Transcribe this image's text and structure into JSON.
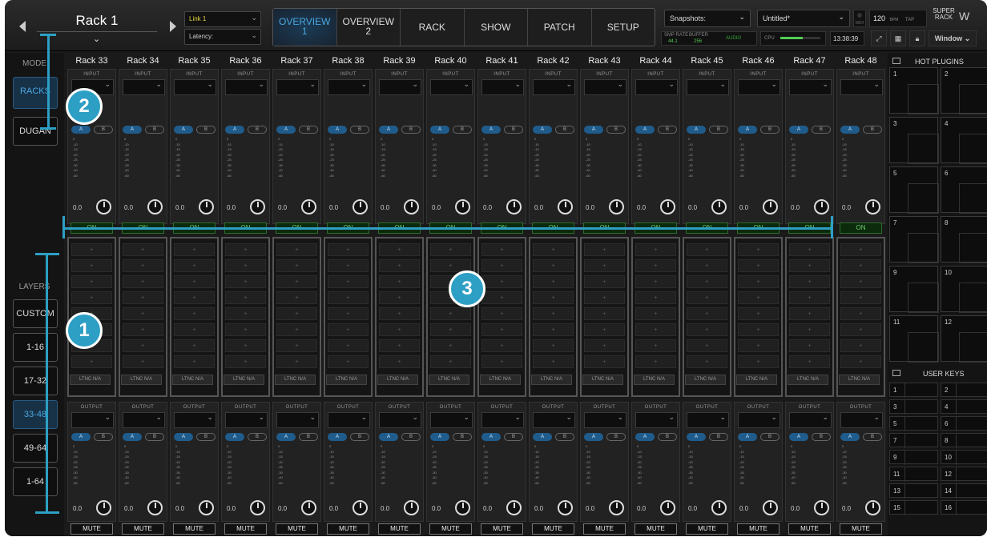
{
  "header": {
    "rack_name": "Rack 1",
    "link_label": "Link 1",
    "latency_label": "Latency:",
    "tabs": [
      {
        "line1": "OVERVIEW",
        "line2": "1",
        "active": true
      },
      {
        "line1": "OVERVIEW",
        "line2": "2",
        "active": false
      },
      {
        "line1": "RACK",
        "line2": "",
        "active": false
      },
      {
        "line1": "SHOW",
        "line2": "",
        "active": false
      },
      {
        "line1": "PATCH",
        "line2": "",
        "active": false
      },
      {
        "line1": "SETUP",
        "line2": "",
        "active": false
      }
    ],
    "snapshots_label": "Snapshots:",
    "snapshot_name": "Untitled*",
    "midi_label": "MIDI",
    "bpm_value": "120",
    "bpm_label": "BPM",
    "tap_label": "TAP",
    "brand": "SUPER RACK",
    "smp_rate_label": "SMP RATE",
    "smp_rate_value": "44.1",
    "buffer_label": "BUFFER",
    "buffer_value": "256",
    "audio_label": "AUDIO",
    "cpu_label": "CPU",
    "cpu_level": 0.55,
    "time": "13:38:39",
    "window_label": "Window"
  },
  "sidebar": {
    "mode_label": "MODE",
    "modes": [
      {
        "label": "RACKS",
        "active": true
      },
      {
        "label": "DUGAN",
        "active": false
      }
    ],
    "layers_label": "LAYERS",
    "layers": [
      {
        "label": "CUSTOM",
        "active": false
      },
      {
        "label": "1-16",
        "active": false
      },
      {
        "label": "17-32",
        "active": false
      },
      {
        "label": "33-48",
        "active": true
      },
      {
        "label": "49-64",
        "active": false
      },
      {
        "label": "1-64",
        "active": false
      }
    ]
  },
  "racks": {
    "names": [
      "Rack 33",
      "Rack 34",
      "Rack 35",
      "Rack 36",
      "Rack 37",
      "Rack 38",
      "Rack 39",
      "Rack 40",
      "Rack 41",
      "Rack 42",
      "Rack 43",
      "Rack 44",
      "Rack 45",
      "Rack 46",
      "Rack 47",
      "Rack 48"
    ],
    "input_label": "INPUT",
    "output_label": "OUTPUT",
    "a_label": "A",
    "b_label": "B",
    "meter_scale": [
      "0",
      "-10",
      "-15",
      "-20",
      "-25",
      "-30",
      "-40",
      "-60"
    ],
    "gain_value": "0.0",
    "on_label": "ON",
    "plugin_slot_symbol": "+",
    "plugin_slots": 8,
    "latency_label": "LTNC",
    "latency_value": "N/A",
    "mute_label": "MUTE"
  },
  "right_panel": {
    "hot_plugins_label": "HOT PLUGINS",
    "hot_plugins": [
      "1",
      "2",
      "3",
      "4",
      "5",
      "6",
      "7",
      "8",
      "9",
      "10",
      "11",
      "12"
    ],
    "user_keys_label": "USER KEYS",
    "user_keys": [
      "1",
      "2",
      "3",
      "4",
      "5",
      "6",
      "7",
      "8",
      "9",
      "10",
      "11",
      "12",
      "13",
      "14",
      "15",
      "16"
    ]
  },
  "annotations": [
    "2",
    "1",
    "3"
  ],
  "colors": {
    "accent": "#4aa8e0",
    "annotation": "#2d9fc4",
    "on_green": "#6fd06f",
    "background": "#1a1a1a"
  }
}
